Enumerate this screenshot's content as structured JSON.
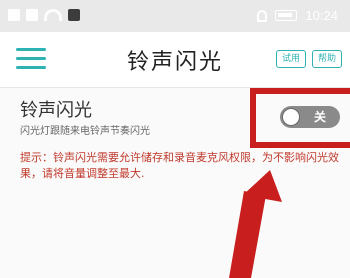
{
  "status_bar": {
    "time": "10:24",
    "left_icons": [
      "image-icon",
      "grid-icon",
      "wifi-icon",
      "app-icon"
    ],
    "right_icons": [
      "silent-bell-icon",
      "battery-icon"
    ]
  },
  "header": {
    "title": "铃声闪光",
    "buttons": {
      "try": "试用",
      "help": "帮助"
    },
    "accent_color": "#2fb3b2"
  },
  "setting": {
    "title": "铃声闪光",
    "subtitle": "闪光灯跟随来电铃声节奏闪光",
    "toggle_state_label": "关",
    "toggle_on": false
  },
  "tip": {
    "text": "提示：铃声闪光需要允许储存和录音麦克风权限，为不影响闪光效果，请将音量调整至最大.",
    "color": "#c0392b"
  },
  "annotation": {
    "highlight_color": "#c81e1e"
  }
}
